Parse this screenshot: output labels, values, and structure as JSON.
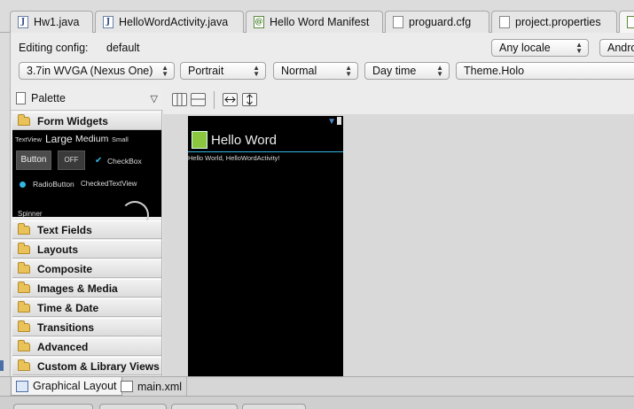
{
  "editor_tabs": [
    {
      "label": "Hw1.java",
      "icon": "java-file-icon"
    },
    {
      "label": "HelloWordActivity.java",
      "icon": "java-file-icon"
    },
    {
      "label": "Hello Word Manifest",
      "icon": "android-manifest-icon"
    },
    {
      "label": "proguard.cfg",
      "icon": "text-file-icon"
    },
    {
      "label": "project.properties",
      "icon": "text-file-icon"
    }
  ],
  "config": {
    "editing_label": "Editing config:",
    "editing_value": "default",
    "locale": "Any locale",
    "android_version": "Andro",
    "device": "3.7in WVGA (Nexus One)",
    "orientation": "Portrait",
    "ui_mode": "Normal",
    "night_mode": "Day time",
    "theme": "Theme.Holo"
  },
  "palette": {
    "title": "Palette",
    "categories": [
      "Form Widgets",
      "Text Fields",
      "Layouts",
      "Composite",
      "Images & Media",
      "Time & Date",
      "Transitions",
      "Advanced",
      "Custom & Library Views"
    ],
    "widgets": {
      "textview_small": "TextView",
      "large": "Large",
      "medium": "Medium",
      "small": "Small",
      "button": "Button",
      "toggle": "OFF",
      "checkbox": "CheckBox",
      "radio": "RadioButton",
      "checked_textview": "CheckedTextView",
      "spinner": "Spinner"
    }
  },
  "device_preview": {
    "app_title": "Hello Word",
    "hello_text": "Hello World, HelloWordActivity!"
  },
  "bottom_tabs": [
    {
      "label": "Graphical Layout",
      "active": true
    },
    {
      "label": "main.xml",
      "active": false
    }
  ],
  "colors": {
    "accent_holo_blue": "#33b5e5",
    "folder_yellow": "#e9c25a",
    "android_green": "#8cc63e"
  }
}
